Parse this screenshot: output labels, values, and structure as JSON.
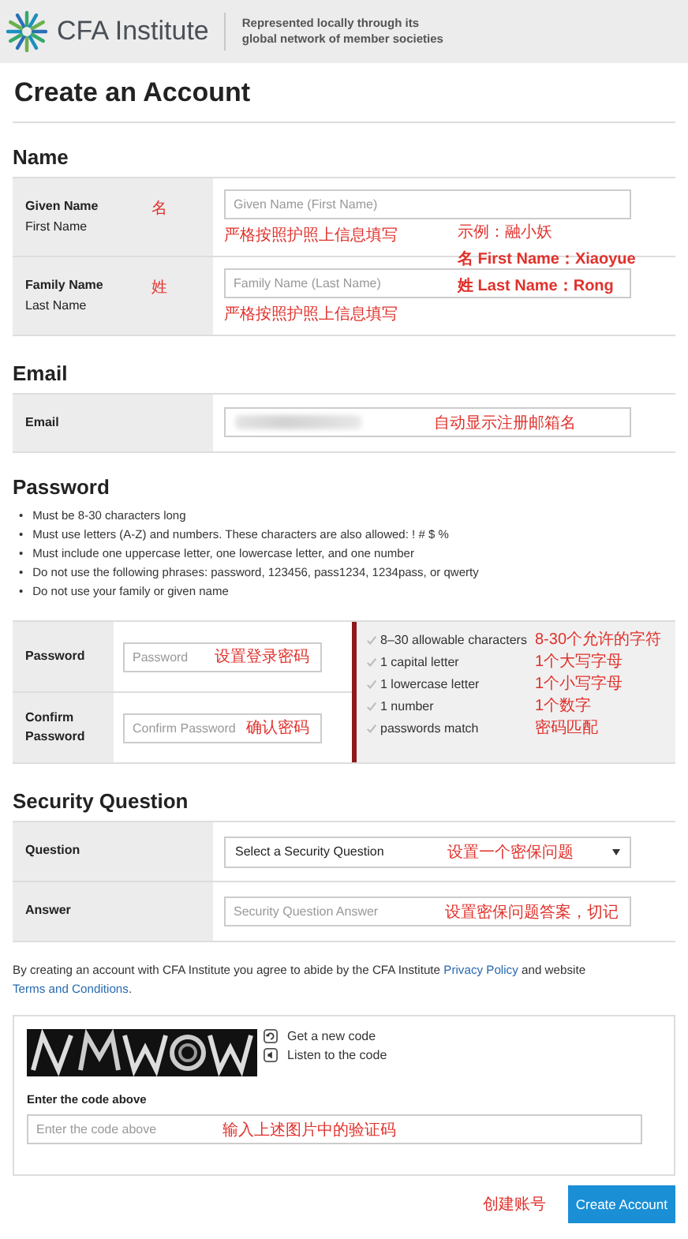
{
  "header": {
    "brand": "CFA Institute",
    "tagline": [
      "Represented locally through its",
      "global network of member societies"
    ]
  },
  "title": "Create an Account",
  "name_section": {
    "heading": "Name",
    "fields": [
      {
        "label": "Given Name",
        "sublabel": "First Name",
        "note": "名",
        "placeholder": "Given Name (First Name)",
        "hint": "严格按照护照上信息填写"
      },
      {
        "label": "Family Name",
        "sublabel": "Last Name",
        "note": "姓",
        "placeholder": "Family Name (Last Name)",
        "hint": "严格按照护照上信息填写"
      }
    ],
    "example": [
      "示例：融小妖",
      "名 First Name：Xiaoyue",
      "姓 Last Name：Rong"
    ]
  },
  "email_section": {
    "heading": "Email",
    "label": "Email",
    "value": {
      "kind": "blurred"
    },
    "note": "自动显示注册邮箱名"
  },
  "password_section": {
    "heading": "Password",
    "bullet": "•",
    "rules": [
      "Must be 8-30 characters long",
      "Must use letters (A-Z) and numbers. These characters are also allowed: ! # $ %",
      "Must include one uppercase letter, one lowercase letter, and one number",
      "Do not use the following phrases: password, 123456, pass1234, 1234pass, or qwerty",
      "Do not use your family or given name"
    ],
    "fields": [
      {
        "label": "Password",
        "placeholder": "Password",
        "note": "设置登录密码"
      },
      {
        "label": "Confirm Password",
        "placeholder": "Confirm Password",
        "note": "确认密码"
      }
    ],
    "checklist": [
      {
        "text": "8–30 allowable characters",
        "note": "8-30个允许的字符",
        "checked": false
      },
      {
        "text": "1 capital letter",
        "note": "1个大写字母",
        "checked": false
      },
      {
        "text": "1 lowercase letter",
        "note": "1个小写字母",
        "checked": false
      },
      {
        "text": "1 number",
        "note": "1个数字",
        "checked": false
      },
      {
        "text": "passwords match",
        "note": "密码匹配",
        "checked": false
      }
    ]
  },
  "security_section": {
    "heading": "Security Question",
    "question": {
      "label": "Question",
      "value": "Select a Security Question",
      "note": "设置一个密保问题"
    },
    "answer": {
      "label": "Answer",
      "placeholder": "Security Question Answer",
      "note": "设置密保问题答案，切记"
    }
  },
  "agreement": {
    "before": "By creating an account with CFA Institute you agree to abide by the CFA Institute",
    "privacy_link": "Privacy Policy",
    "middle": "and website",
    "terms_link": "Terms and Conditions",
    "after": "."
  },
  "captcha": {
    "image": {
      "kind": "picture"
    },
    "links": [
      "Get a new code",
      "Listen to the code"
    ],
    "label": "Enter the code above",
    "placeholder": "Enter the code above",
    "note": "输入上述图片中的验证码"
  },
  "submit": {
    "note": "创建账号",
    "label": "Create Account"
  }
}
